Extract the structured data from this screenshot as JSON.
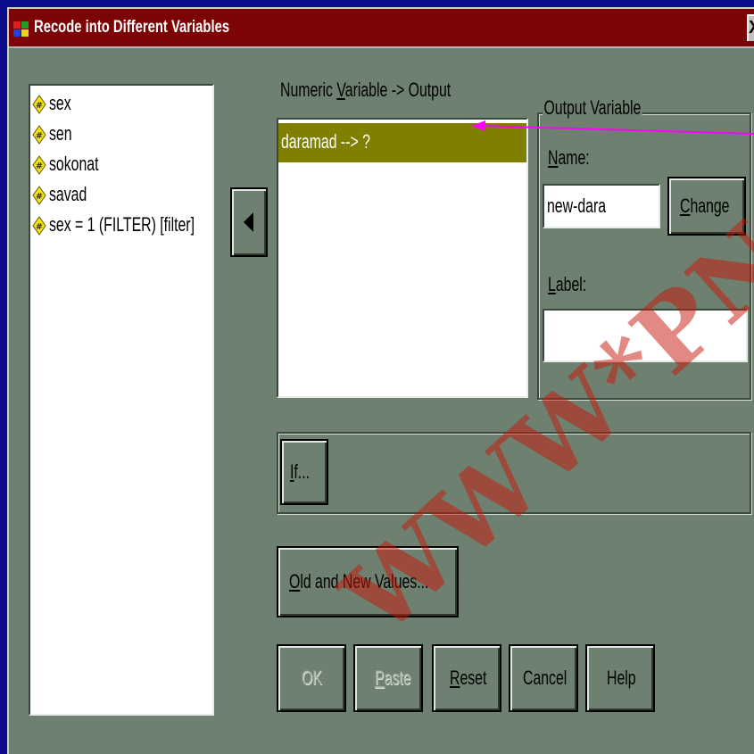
{
  "window": {
    "title": "Recode into Different Variables",
    "close_glyph": "X"
  },
  "source_list": {
    "items": [
      {
        "label": "sex",
        "icon": "numeric-variable-icon"
      },
      {
        "label": "sen",
        "icon": "numeric-variable-icon"
      },
      {
        "label": "sokonat",
        "icon": "numeric-variable-icon"
      },
      {
        "label": "savad",
        "icon": "numeric-variable-icon"
      },
      {
        "label": "sex = 1 (FILTER) [filter]",
        "icon": "numeric-variable-icon"
      }
    ]
  },
  "numeric_variable": {
    "label_pre": "Numeric ",
    "label_mnemonic": "V",
    "label_post": "ariable -> Output",
    "items": [
      "daramad --> ?"
    ]
  },
  "output_variable": {
    "group_title": "Output Variable",
    "name_label_mnemonic": "N",
    "name_label_rest": "ame:",
    "name_value": "new-dara",
    "change_mnemonic": "C",
    "change_rest": "hange",
    "label_label_mnemonic": "L",
    "label_label_rest": "abel:",
    "label_value": ""
  },
  "buttons": {
    "if_mnemonic": "I",
    "if_rest": "f...",
    "old_new_mnemonic": "O",
    "old_new_rest": "ld and New Values...",
    "ok": "OK",
    "paste_mnemonic": "P",
    "paste_rest": "aste",
    "reset_mnemonic": "R",
    "reset_rest": "eset",
    "cancel": "Cancel",
    "help": "Help"
  },
  "watermark": "WWW*PN",
  "colors": {
    "dialog_bg": "#6e806f",
    "titlebar": "#7c0404",
    "selection": "#7f7f00",
    "annotation_arrow": "#ff00ff",
    "desktop": "#0c0c8a"
  }
}
